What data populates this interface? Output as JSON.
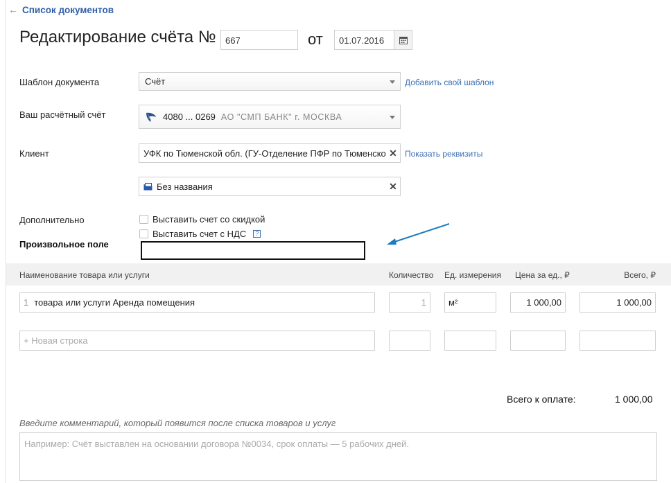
{
  "nav": {
    "back_arrow": "←",
    "back_label": "Список документов"
  },
  "header": {
    "title": "Редактирование счёта №",
    "number": "667",
    "ot": "от",
    "date": "01.07.2016"
  },
  "form": {
    "template_label": "Шаблон документа",
    "template_value": "Счёт",
    "add_template_link": "Добавить свой шаблон",
    "account_label": "Ваш расчётный счёт",
    "account_number": "4080 ... 0269",
    "account_bank": "АО \"СМП БАНК\" г. МОСКВА",
    "client_label": "Клиент",
    "client_value": "УФК по Тюменской обл. (ГУ-Отделение ПФР по Тюменской обл.)",
    "show_details_link": "Показать реквизиты",
    "contract_value": "Без названия",
    "clear_symbol": "✕",
    "extra_label": "Дополнительно",
    "discount_label": "Выставить счет со скидкой",
    "vat_label": "Выставить счет с НДС",
    "vat_help": "?",
    "custom_field_label": "Произвольное поле",
    "custom_field_value": ""
  },
  "table": {
    "headers": {
      "name": "Наименование товара или услуги",
      "qty": "Количество",
      "unit": "Ед. измерения",
      "price": "Цена за ед., ₽",
      "total": "Всего, ₽"
    },
    "rows": [
      {
        "index": "1",
        "name": "товара или услуги Аренда помещения",
        "qty": "1",
        "unit": "м²",
        "price": "1 000,00",
        "total": "1 000,00"
      }
    ],
    "new_row_placeholder": "+ Новая строка"
  },
  "totals": {
    "label": "Всего к оплате:",
    "value": "1 000,00"
  },
  "comment": {
    "label": "Введите комментарий, который появится после списка товаров и услуг",
    "placeholder": "Например: Счёт выставлен на основании договора №0034, срок оплаты — 5 рабочих дней."
  },
  "colors": {
    "link": "#3a6fb5",
    "annotation_arrow": "#1b7bbf"
  },
  "icons": [
    "back-arrow-icon",
    "calendar-icon",
    "bank-logo-icon",
    "document-icon",
    "clear-icon",
    "help-icon"
  ]
}
